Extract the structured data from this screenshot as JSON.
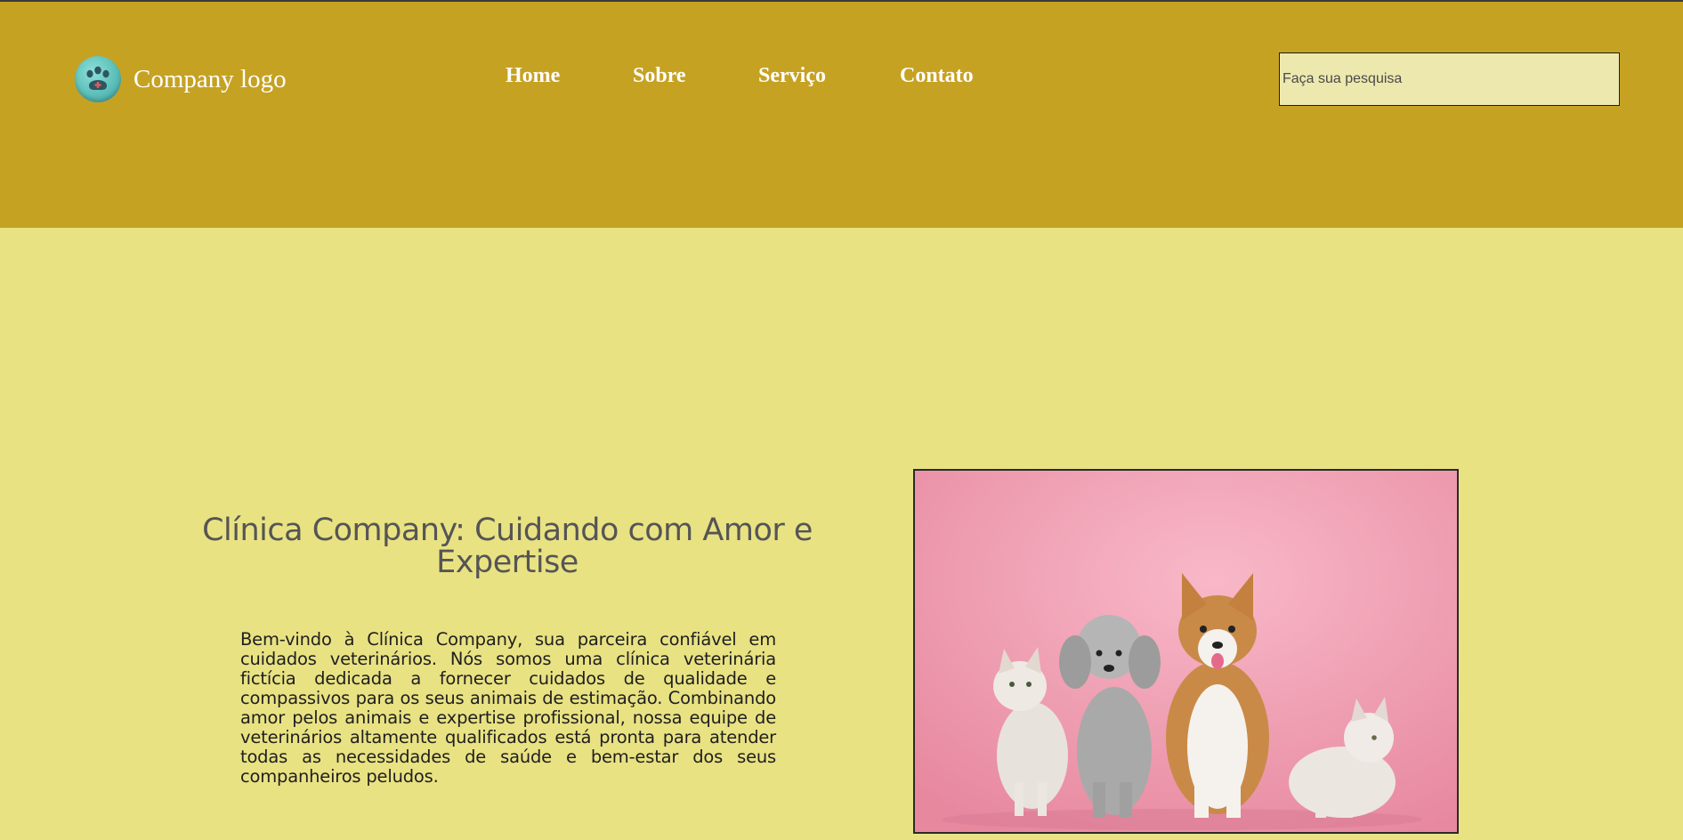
{
  "header": {
    "logo_text": "Company logo",
    "nav": [
      {
        "label": "Home"
      },
      {
        "label": "Sobre"
      },
      {
        "label": "Serviço"
      },
      {
        "label": "Contato"
      }
    ],
    "search": {
      "placeholder": "Faça sua pesquisa",
      "value": ""
    }
  },
  "hero": {
    "title": "Clínica Company: Cuidando com Amor e Expertise",
    "paragraph": "Bem-vindo à Clínica Company, sua parceira confiável em cuidados veterinários. Nós somos uma clínica veterinária fictícia dedicada a fornecer cuidados de qualidade e compassivos para os seus animais de estimação. Combinando amor pelos animais e expertise profissional, nossa equipe de veterinários altamente qualificados está pronta para atender todas as necessidades de saúde e bem-estar dos seus companheiros peludos."
  },
  "colors": {
    "header_bg": "#c6a223",
    "page_bg": "#e9e283",
    "search_bg": "#ede8ae",
    "title_text": "#555555",
    "image_bg": "#ef9fb5"
  },
  "icons": {
    "logo": "paw-icon"
  }
}
